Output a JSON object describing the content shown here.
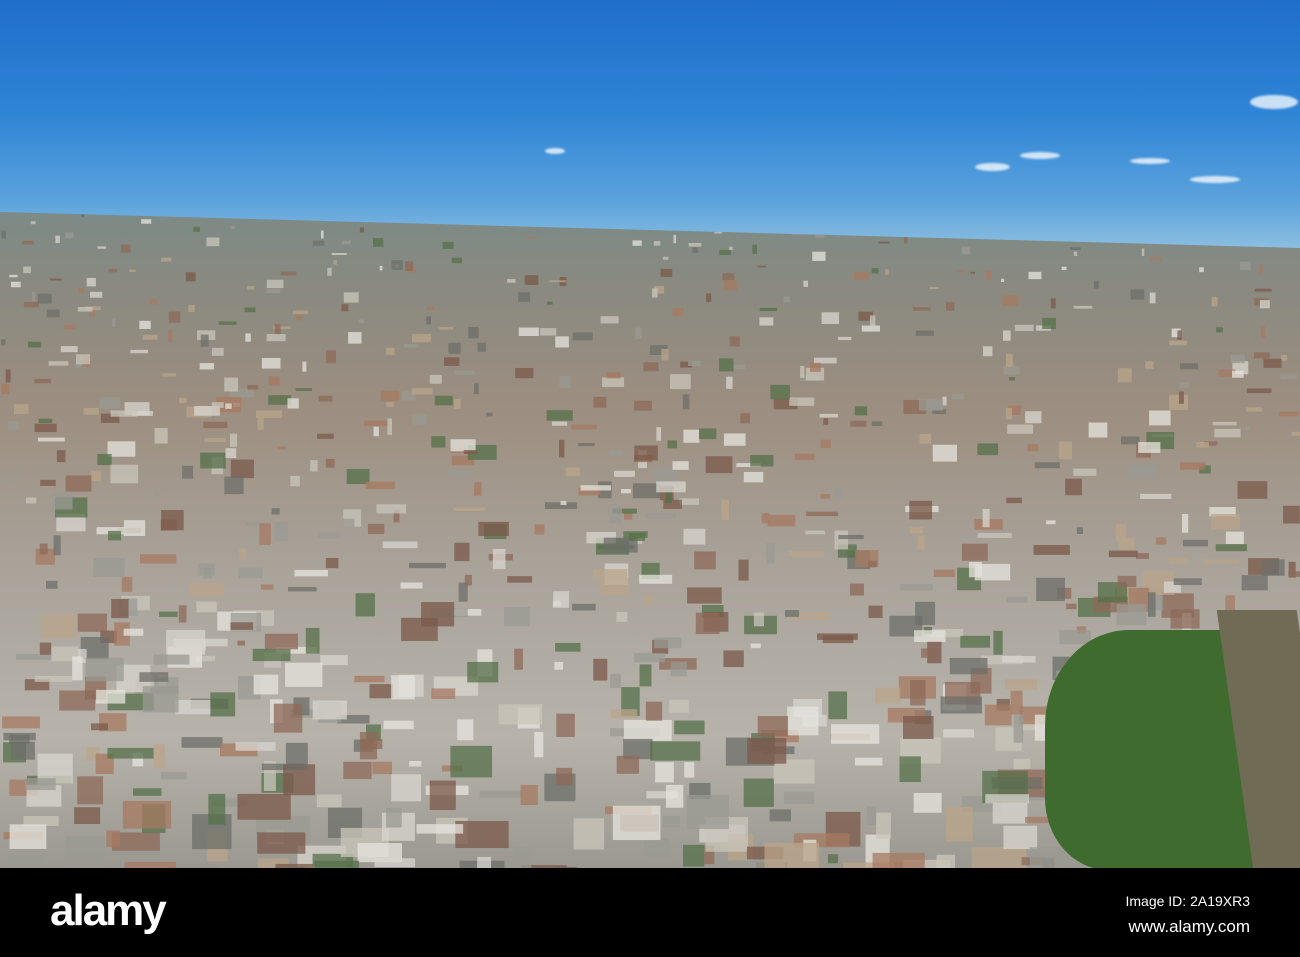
{
  "watermark": {
    "logo": "alamy",
    "image_id": "Image ID: 2A19XR3",
    "website": "www.alamy.com"
  }
}
